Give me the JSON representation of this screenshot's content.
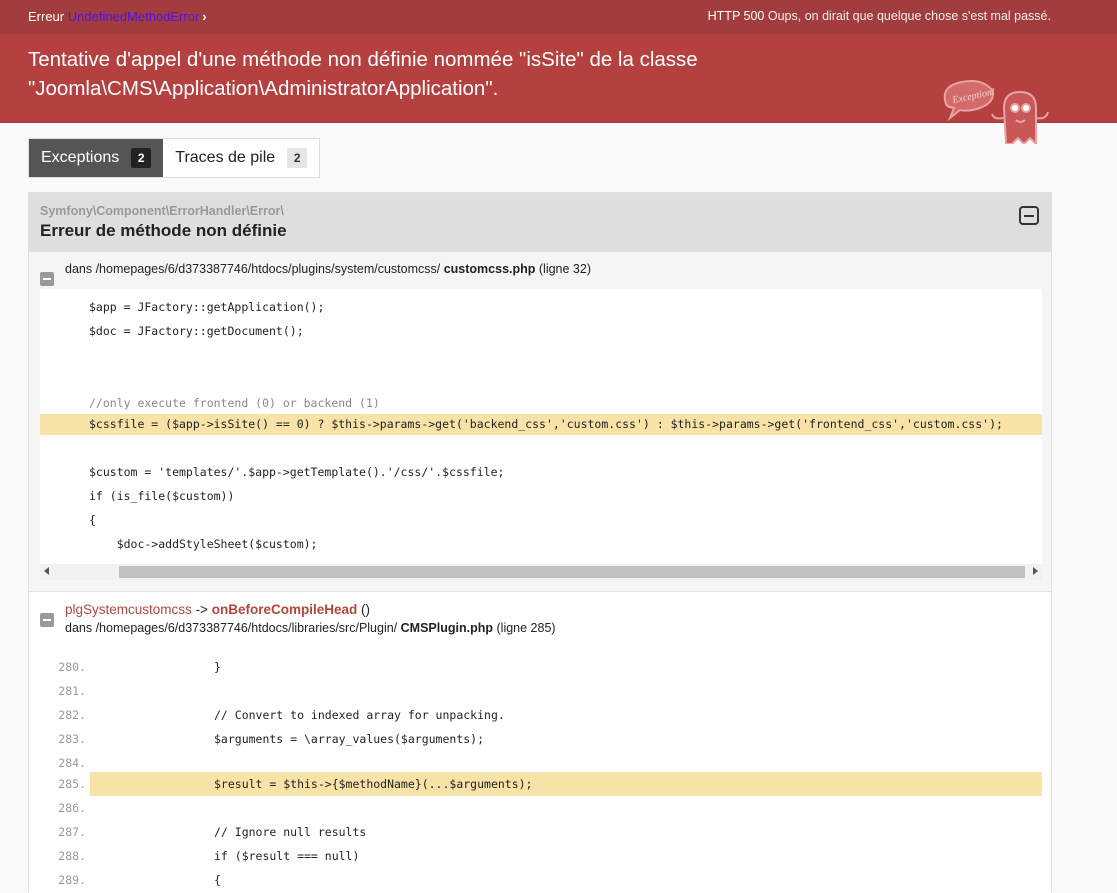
{
  "topbar": {
    "label": "Erreur",
    "exception_class": "UndefinedMethodError",
    "status_code": "HTTP 500",
    "status_text": "Oups, on dirait que quelque chose s'est mal passé."
  },
  "banner": {
    "message": "Tentative d'appel d'une méthode non définie nommée \"isSite\" de la classe \"Joomla\\CMS\\Application\\AdministratorApplication\".",
    "logo_text": "Exception!"
  },
  "tabs": [
    {
      "label": "Exceptions",
      "count": "2",
      "active": true
    },
    {
      "label": "Traces de pile",
      "count": "2",
      "active": false
    }
  ],
  "exception": {
    "namespace": "Symfony\\Component\\ErrorHandler\\Error\\",
    "title": "Erreur de méthode non définie"
  },
  "trace1": {
    "prefix": "dans /homepages/6/d373387746/htdocs/plugins/system/customcss/",
    "file": "customcss.php",
    "line": "(ligne 32)",
    "code": [
      "$app = JFactory::getApplication();",
      "$doc = JFactory::getDocument();",
      "",
      "",
      "//only execute frontend (0) or backend (1)",
      "$cssfile = ($app->isSite() == 0) ? $this->params->get('backend_css','custom.css') : $this->params->get('frontend_css','custom.css');",
      "",
      "$custom = 'templates/'.$app->getTemplate().'/css/'.$cssfile;",
      "if (is_file($custom))",
      "{",
      "    $doc->addStyleSheet($custom);"
    ]
  },
  "trace2": {
    "class": "plgSystemcustomcss",
    "arrow": "->",
    "method": "onBeforeCompileHead",
    "args": "()",
    "prefix": "dans /homepages/6/d373387746/htdocs/libraries/src/Plugin/",
    "file": "CMSPlugin.php",
    "line": "(ligne 285)",
    "lines": [
      {
        "n": "280.",
        "t": "}"
      },
      {
        "n": "281.",
        "t": ""
      },
      {
        "n": "282.",
        "t": "// Convert to indexed array for unpacking."
      },
      {
        "n": "283.",
        "t": "$arguments = \\array_values($arguments);"
      },
      {
        "n": "284.",
        "t": ""
      },
      {
        "n": "285.",
        "t": "$result = $this->{$methodName}(...$arguments);"
      },
      {
        "n": "286.",
        "t": ""
      },
      {
        "n": "287.",
        "t": "// Ignore null results"
      },
      {
        "n": "288.",
        "t": "if ($result === null)"
      },
      {
        "n": "289.",
        "t": "{"
      }
    ]
  },
  "colors": {
    "topbar": "#a33d3d",
    "banner": "#b54040",
    "highlight": "#f7e2a7",
    "exception_class_link": "#4d14e9"
  }
}
